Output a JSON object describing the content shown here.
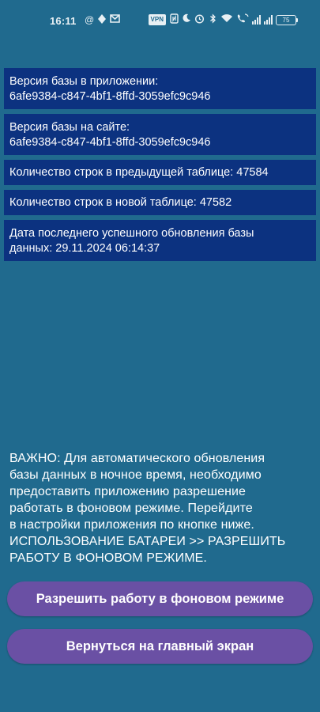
{
  "status_bar": {
    "time": "16:11",
    "vpn_label": "VPN",
    "battery_level": "75",
    "left_icons": [
      "at-icon",
      "navigation-icon",
      "gmail-icon"
    ],
    "right_icons": [
      "vpn-icon",
      "nfc-icon",
      "do-not-disturb-icon",
      "alarm-icon",
      "bluetooth-icon",
      "wifi-icon",
      "wifi-calling-icon",
      "signal-icon",
      "signal-icon",
      "battery-icon"
    ]
  },
  "info": {
    "app_version_label": "Версия базы в приложении:",
    "app_version_value": "6afe9384-c847-4bf1-8ffd-3059efc9c946",
    "site_version_label": "Версия базы на сайте:",
    "site_version_value": "6afe9384-c847-4bf1-8ffd-3059efc9c946",
    "prev_rows": "Количество строк в предыдущей таблице: 47584",
    "new_rows": "Количество строк в новой таблице: 47582",
    "last_update_label": "Дата последнего успешного обновления базы",
    "last_update_value": "данных: 29.11.2024 06:14:37"
  },
  "note": {
    "lines": [
      "ВАЖНО: Для автоматического обновления",
      "базы данных в ночное время, необходимо",
      "предоставить приложению разрешение",
      "работать в фоновом режиме. Перейдите",
      "в настройки приложения по кнопке ниже.",
      "ИСПОЛЬЗОВАНИЕ БАТАРЕИ >> РАЗРЕШИТЬ",
      "РАБОТУ В ФОНОВОМ РЕЖИМЕ."
    ]
  },
  "buttons": {
    "allow_background": "Разрешить работу в фоновом режиме",
    "back_home": "Вернуться на главный экран"
  },
  "colors": {
    "background": "#206a8e",
    "info_box": "#0c3280",
    "button": "#6a50a4",
    "text": "#ffffff"
  }
}
